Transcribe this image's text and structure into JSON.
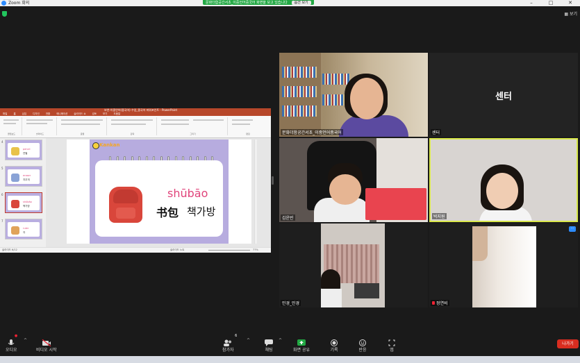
{
  "window": {
    "title": "Zoom 회의",
    "controls": [
      "–",
      "□",
      "✕"
    ]
  },
  "share_banner": {
    "text": "문화더함공간서초_이중언어중국어 화면을 보고 있습니다",
    "button": "옵션 보기"
  },
  "view_button": "보기",
  "powerpoint": {
    "window_title": "보연-이중언어(중국어) 수업_중국어 파워포인트 - PowerPoint",
    "tabs": [
      "파일",
      "홈",
      "삽입",
      "디자인",
      "전환",
      "애니메이션",
      "슬라이드 쇼",
      "검토",
      "보기",
      "도움말"
    ],
    "ribbon_groups": [
      "클립보드",
      "슬라이드",
      "글꼴",
      "단락",
      "그리기",
      "편집"
    ],
    "thumbnails": [
      {
        "num": "4",
        "word": "pencil",
        "ko": "연필"
      },
      {
        "num": "5",
        "word": "eraser",
        "ko": "지우개"
      },
      {
        "num": "6",
        "word": "shūbāo",
        "ko": "책가방"
      },
      {
        "num": "7",
        "word": "ruler",
        "ko": "자"
      }
    ],
    "slide": {
      "logo": "Kankan",
      "pinyin": "shūbāo",
      "hanzi": "书包",
      "korean": "책가방"
    },
    "status_left": "슬라이드 6/12",
    "status_right": "슬라이드 노트",
    "zoom": "77%"
  },
  "participants": [
    {
      "name": "문화더함공간서초_이중언어중국어"
    },
    {
      "name": "센터",
      "display": "센터"
    },
    {
      "name": "김윤빈"
    },
    {
      "name": "박지원"
    },
    {
      "name": "민경_민경"
    },
    {
      "name": "정연비"
    }
  ],
  "toolbar": {
    "audio": "오디오",
    "video": "비디오 시작",
    "participants": "참가자",
    "participants_count": "6",
    "chat": "채팅",
    "share": "화면 공유",
    "record": "기록",
    "reactions": "반응",
    "apps": "앱",
    "leave": "나가기"
  },
  "colors": {
    "share_green": "#22a843",
    "leave_red": "#d92d20",
    "active_speaker": "#d9e84a",
    "pinyin_pink": "#e0437a"
  }
}
